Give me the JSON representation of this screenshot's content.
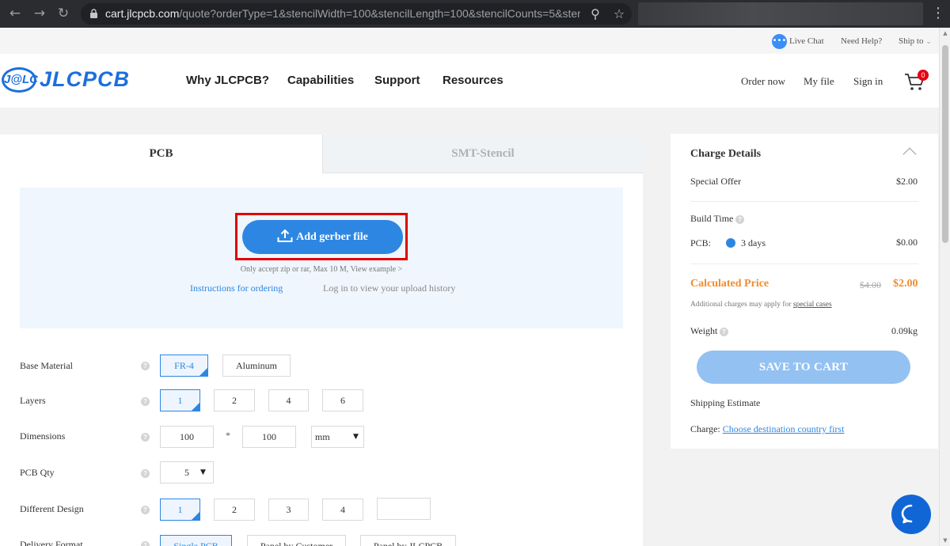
{
  "browser": {
    "url_host": "cart.jlcpcb.com",
    "url_path": "/quote?orderType=1&stencilWidth=100&stencilLength=100&stencilCounts=5&stencil..."
  },
  "topbar": {
    "live_chat": "Live Chat",
    "need_help": "Need Help?",
    "ship_to": "Ship to"
  },
  "header": {
    "logo_mark": "J@LC",
    "logo_text": "JLCPCB",
    "nav": [
      "Why JLCPCB?",
      "Capabilities",
      "Support",
      "Resources"
    ],
    "order_now": "Order now",
    "my_file": "My file",
    "sign_in": "Sign in",
    "cart_count": "0"
  },
  "tabs": {
    "pcb": "PCB",
    "stencil": "SMT-Stencil"
  },
  "upload": {
    "button": "Add gerber file",
    "note": "Only accept zip or rar, Max 10 M, View example >",
    "instructions": "Instructions for ordering",
    "history": "Log in to view your upload history"
  },
  "options": {
    "base_material": {
      "label": "Base Material",
      "choices": [
        "FR-4",
        "Aluminum"
      ],
      "selected": "FR-4"
    },
    "layers": {
      "label": "Layers",
      "choices": [
        "1",
        "2",
        "4",
        "6"
      ],
      "selected": "1"
    },
    "dimensions": {
      "label": "Dimensions",
      "width": "100",
      "times": "*",
      "length": "100",
      "unit": "mm"
    },
    "pcb_qty": {
      "label": "PCB Qty",
      "value": "5"
    },
    "different_design": {
      "label": "Different Design",
      "choices": [
        "1",
        "2",
        "3",
        "4"
      ],
      "selected": "1",
      "custom": ""
    },
    "delivery_format": {
      "label": "Delivery Format",
      "choices": [
        "Single PCB",
        "Panel by Customer",
        "Panel by JLCPCB"
      ],
      "selected": "Single PCB"
    },
    "help_glyph": "?"
  },
  "charge": {
    "title": "Charge Details",
    "special_offer_label": "Special Offer",
    "special_offer_value": "$2.00",
    "build_time_label": "Build Time",
    "pcb_label": "PCB:",
    "pcb_days": "3 days",
    "pcb_price": "$0.00",
    "calculated_label": "Calculated Price",
    "old_price": "$4.00",
    "new_price": "$2.00",
    "additional_note": "Additional charges may apply for",
    "special_cases": "special cases",
    "weight_label": "Weight",
    "weight_value": "0.09kg",
    "save_button": "SAVE TO CART",
    "shipping_estimate": "Shipping Estimate",
    "charge_label": "Charge:",
    "choose_country": "Choose destination country first"
  },
  "colors": {
    "brand_blue": "#1b6fdc",
    "button_blue": "#2d87e2",
    "highlight_red": "#e00000",
    "price_orange": "#f08c2e"
  }
}
